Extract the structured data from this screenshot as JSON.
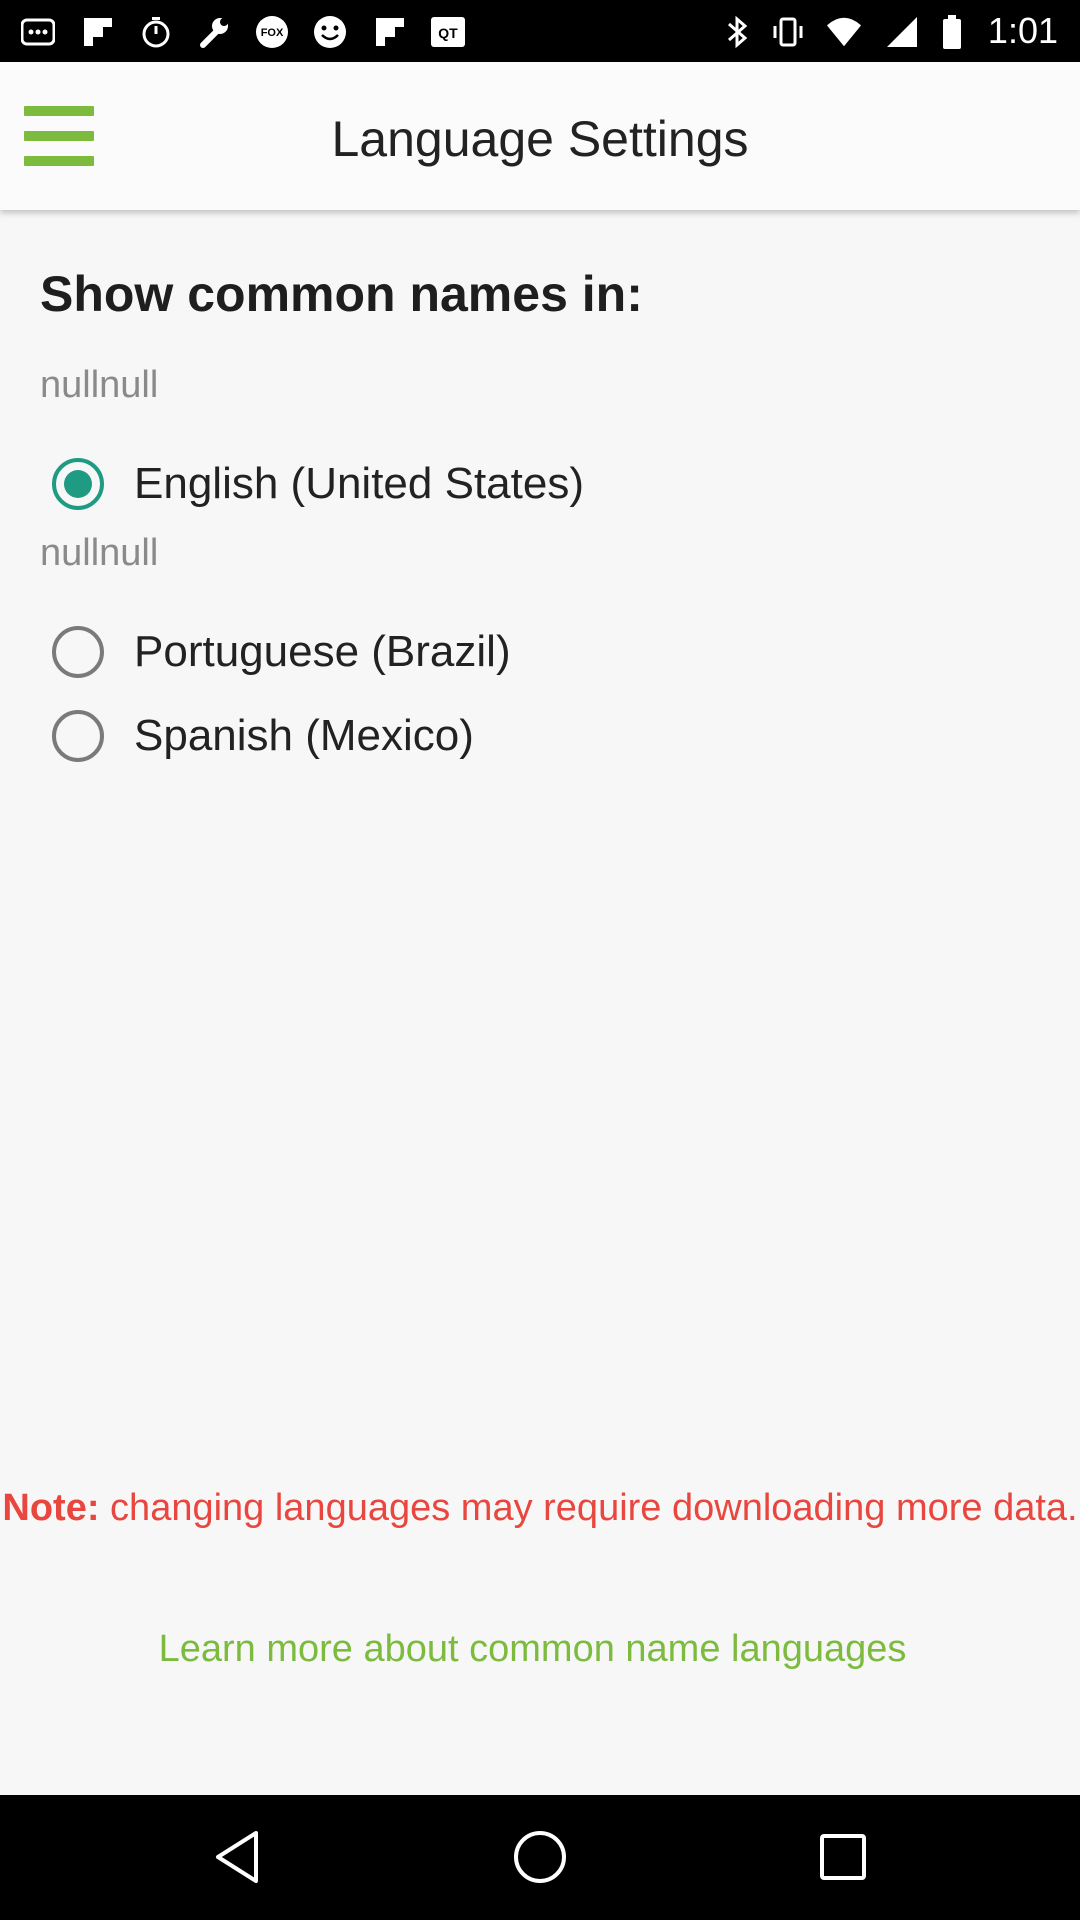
{
  "status_bar": {
    "icons": [
      "more-dots-icon",
      "flipboard-icon",
      "timer-icon",
      "wrench-icon",
      "fox-sports-icon",
      "smiley-icon",
      "flipboard-icon",
      "qt-icon",
      "bluetooth-icon",
      "vibrate-icon",
      "wifi-icon",
      "signal-icon",
      "battery-icon"
    ],
    "fox_text": "FOX",
    "qt_text": "QT",
    "time": "1:01"
  },
  "app_bar": {
    "menu_icon": "hamburger-menu-icon",
    "title": "Language Settings"
  },
  "settings": {
    "section_title": "Show common names in:",
    "groups": [
      {
        "label": "nullnull",
        "options": [
          {
            "label": "English (United States)",
            "selected": true
          }
        ]
      },
      {
        "label": "nullnull",
        "options": [
          {
            "label": "Portuguese (Brazil)",
            "selected": false
          },
          {
            "label": "Spanish (Mexico)",
            "selected": false
          }
        ]
      }
    ]
  },
  "note": {
    "prefix": "Note:",
    "text": " changing languages may require downloading more data."
  },
  "learn_more_link": "Learn more about common name languages",
  "nav_bar": {
    "icons": [
      "back-icon",
      "home-icon",
      "recents-icon"
    ]
  },
  "colors": {
    "accent_green": "#7cbb3e",
    "radio_teal": "#1f9b83",
    "note_red": "#e8463e"
  }
}
